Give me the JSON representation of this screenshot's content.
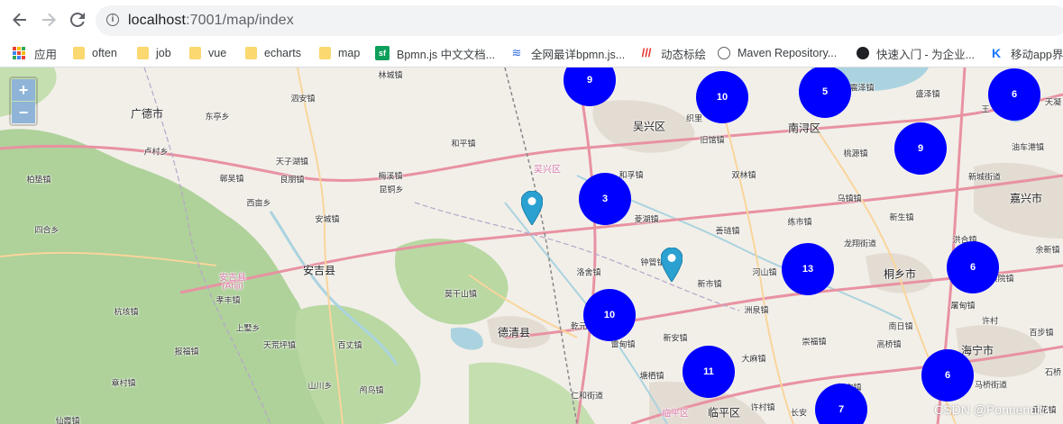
{
  "browser": {
    "url_host": "localhost",
    "url_rest": ":7001/map/index"
  },
  "bookmarks": [
    {
      "label": "应用",
      "icon": "apps-icon"
    },
    {
      "label": "often",
      "icon": "folder-icon"
    },
    {
      "label": "job",
      "icon": "folder-icon"
    },
    {
      "label": "vue",
      "icon": "folder-icon"
    },
    {
      "label": "echarts",
      "icon": "folder-icon"
    },
    {
      "label": "map",
      "icon": "folder-icon"
    },
    {
      "label": "Bpmn.js 中文文档...",
      "icon": "sf-icon"
    },
    {
      "label": "全网最详bpmn.js...",
      "icon": "juejin-icon"
    },
    {
      "label": "动态标绘",
      "icon": "stripes-icon"
    },
    {
      "label": "Maven Repository...",
      "icon": "globe-icon"
    },
    {
      "label": "快速入门 - 为企业...",
      "icon": "dark-logo-icon"
    },
    {
      "label": "移动app界",
      "icon": "k-logo-icon"
    }
  ],
  "map": {
    "zoom_in": "+",
    "zoom_out": "−",
    "watermark": "CSDN @Ponnenult",
    "clusters": [
      "9",
      "10",
      "5",
      "6",
      "9",
      "3",
      "13",
      "6",
      "10",
      "11",
      "6",
      "7"
    ],
    "places": {
      "guangde": "广德市",
      "dongting": "东亭乡",
      "luchun": "卢村乡",
      "baiding": "柏垫镇",
      "siheliang": "四合乡",
      "tianzihu": "天子湖镇",
      "heng": "鄣吴镇",
      "liangpeng": "良朋镇",
      "xifan": "西亩乡",
      "meixi": "梅溪镇",
      "kunyang": "昆铜乡",
      "anchengzhen": "安城镇",
      "anji": "安吉县",
      "anji_cn": "安吉县",
      "anji_pinyin": "(Anji)",
      "xiaofeng": "孝丰镇",
      "shangshu": "上墅乡",
      "hangkai": "杭垓镇",
      "baofu": "报福镇",
      "tianhuang": "天荒坪镇",
      "baizhang": "百丈镇",
      "zhangcun": "章村镇",
      "shanchuan": "山川乡",
      "niaogou": "鸬鸟镇",
      "xianxia": "仙霞镇",
      "sian": "泗安镇",
      "linchengzhen": "林城镇",
      "heping": "和平镇",
      "wuxing": "吴兴区",
      "wuxing_pink": "吴兴区",
      "zhili": "织里",
      "jiuguan": "旧馆镇",
      "nanxun": "南浔区",
      "lingge": "菱湖镇",
      "shuanglin": "双林镇",
      "heuanfu": "和孚镇",
      "luoshe": "洛舍镇",
      "zhongguan": "钟管镇",
      "xinshi": "新市镇",
      "moganshan": "莫干山镇",
      "deqing": "德清县",
      "qianyuan": "乾元",
      "leidian": "雷甸镇",
      "xin_an": "新安镇",
      "tangqi": "塘栖镇",
      "renhe": "仁和街道",
      "linping": "临平区",
      "linping_pink": "临平区",
      "xucun": "许村镇",
      "changan": "长安",
      "danian": "大麻镇",
      "zhouquan": "洲泉镇",
      "heshan": "河山镇",
      "lianshi": "练市镇",
      "shanlian": "善琏镇",
      "wuzhen": "乌镇镇",
      "taoyuan": "桃源镇",
      "longxiang": "龙翔街道",
      "tongxiang": "桐乡市",
      "xinsheng": "新生镇",
      "chongfu": "崇福镇",
      "nanri": "南日镇",
      "gaoqiao": "高桥镇",
      "tuodian": "屠甸镇",
      "haining": "海宁市",
      "changan2": "长安镇",
      "jiaxing": "嘉兴市",
      "xincheng": "新城街道",
      "youche": "油车港镇",
      "shengze": "盛泽镇",
      "qingze": "震泽镇",
      "honghe": "洪合镇",
      "yuxin": "余新镇",
      "puyuan": "濮院镇",
      "xuchang": "许村",
      "baibu": "百步镇",
      "shiqiao": "石桥",
      "maqiao": "马桥街道",
      "yuanhua": "袁花镇",
      "tianning": "天凝",
      "wang": "王"
    }
  },
  "colors": {
    "cluster": "#0000ff",
    "marker": "#2aa1d1",
    "water": "#aad3df",
    "forest": "#aed29a",
    "primary_road": "#f4a3a9",
    "secondary_road": "#f9d59b"
  }
}
